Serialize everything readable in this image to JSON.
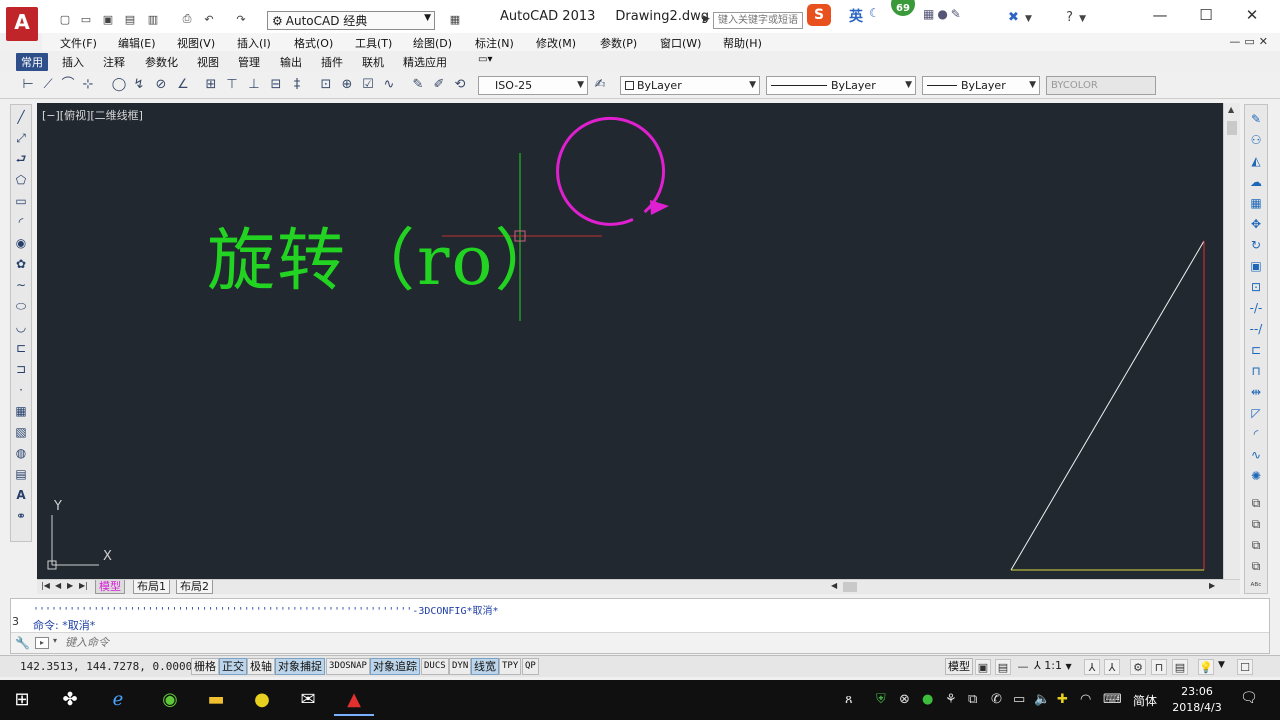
{
  "titlebar": {
    "logo_letter": "A",
    "workspace": "AutoCAD 经典",
    "app_name": "AutoCAD 2013",
    "doc_name": "Drawing2.dwg",
    "search_placeholder": "键入关键字或短语",
    "ime_lang": "英",
    "ime_badge": "69",
    "help": "?"
  },
  "menubar": {
    "items": [
      "文件(F)",
      "编辑(E)",
      "视图(V)",
      "插入(I)",
      "格式(O)",
      "工具(T)",
      "绘图(D)",
      "标注(N)",
      "修改(M)",
      "参数(P)",
      "窗口(W)",
      "帮助(H)"
    ]
  },
  "ribbon_tabs": {
    "items": [
      "常用",
      "插入",
      "注释",
      "参数化",
      "视图",
      "管理",
      "输出",
      "插件",
      "联机",
      "精选应用"
    ],
    "active": "常用"
  },
  "toolbar": {
    "dim_style": "ISO-25",
    "layer_color": "ByLayer",
    "linetype": "ByLayer",
    "lineweight": "ByLayer",
    "plot_style": "BYCOLOR"
  },
  "viewport": {
    "label": "[−][俯视][二维线框]",
    "drawing_text": "旋转（ro）",
    "ucs_x": "X",
    "ucs_y": "Y",
    "colors": {
      "background": "#212830",
      "text": "#22d322",
      "crosshair": "#22d322",
      "circle_arrow": "#e020d0",
      "triangle_hyp": "#f0f0f0",
      "triangle_vert": "#e03030",
      "triangle_base": "#d8d840"
    }
  },
  "layout_tabs": {
    "items": [
      "模型",
      "布局1",
      "布局2"
    ],
    "active": "模型"
  },
  "command": {
    "history_1": "'''''''''''''''''''''''''''''''''''''''''''''''''''''''''''''''-3DCONFIG*取消*",
    "history_2": "命令: *取消*",
    "input_placeholder": "键入命令",
    "side_num": "3"
  },
  "statusbar": {
    "coords": "142.3513, 144.7278, 0.0000",
    "buttons": [
      {
        "label": "栅格",
        "on": false
      },
      {
        "label": "正交",
        "on": true
      },
      {
        "label": "极轴",
        "on": false
      },
      {
        "label": "对象捕捉",
        "on": true
      },
      {
        "label": "3DOSNAP",
        "on": false
      },
      {
        "label": "对象追踪",
        "on": true
      },
      {
        "label": "DUCS",
        "on": false
      },
      {
        "label": "DYN",
        "on": false
      },
      {
        "label": "线宽",
        "on": true
      },
      {
        "label": "TPY",
        "on": false
      },
      {
        "label": "QP",
        "on": false
      }
    ],
    "model_label": "模型",
    "annotation_scale": "1:1"
  },
  "taskbar": {
    "tray_lang": "简体",
    "time": "23:06",
    "date": "2018/4/3"
  }
}
